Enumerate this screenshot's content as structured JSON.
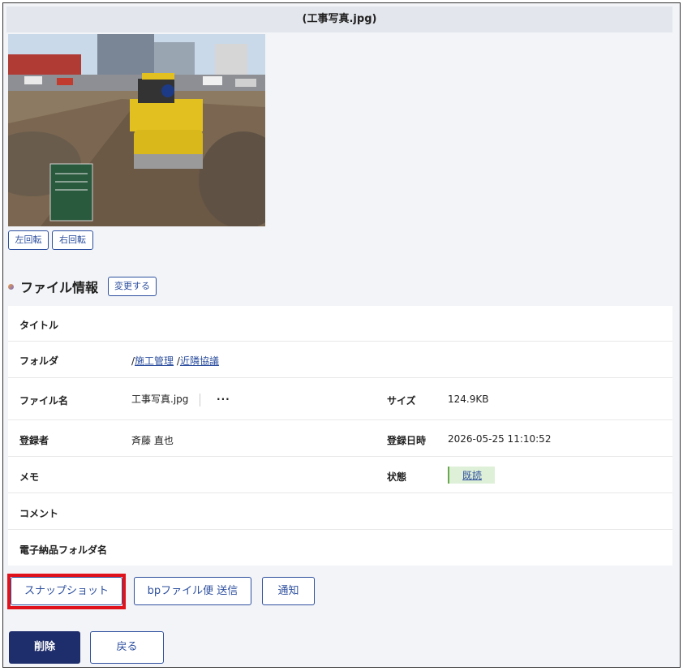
{
  "header": {
    "title": "(工事写真.jpg)"
  },
  "image_tools": {
    "rotate_left": "左回転",
    "rotate_right": "右回転"
  },
  "file_info": {
    "section_title": "ファイル情報",
    "change_label": "変更する",
    "rows": {
      "title_label": "タイトル",
      "folder_label": "フォルダ",
      "folder_path": [
        {
          "sep": "/",
          "name": "施工管理"
        },
        {
          "sep": "/",
          "name": "近隣協議"
        }
      ],
      "filename_label": "ファイル名",
      "filename_value": "工事写真.jpg",
      "more_menu": "···",
      "size_label": "サイズ",
      "size_value": "124.9KB",
      "registrant_label": "登録者",
      "registrant_value": "斉藤 直也",
      "registered_at_label": "登録日時",
      "registered_at_value": "2026-05-25 11:10:52",
      "memo_label": "メモ",
      "status_label": "状態",
      "status_value": "既読",
      "comment_label": "コメント",
      "delivery_folder_label": "電子納品フォルダ名"
    }
  },
  "actions": {
    "snapshot": "スナップショット",
    "bp_send": "bpファイル便 送信",
    "notify": "通知",
    "delete": "削除",
    "back": "戻る"
  },
  "colors": {
    "accent": "#2d4f9e",
    "primary_button": "#1e2d6b",
    "highlight": "#e0121b",
    "status_bg": "#dff0d8"
  }
}
